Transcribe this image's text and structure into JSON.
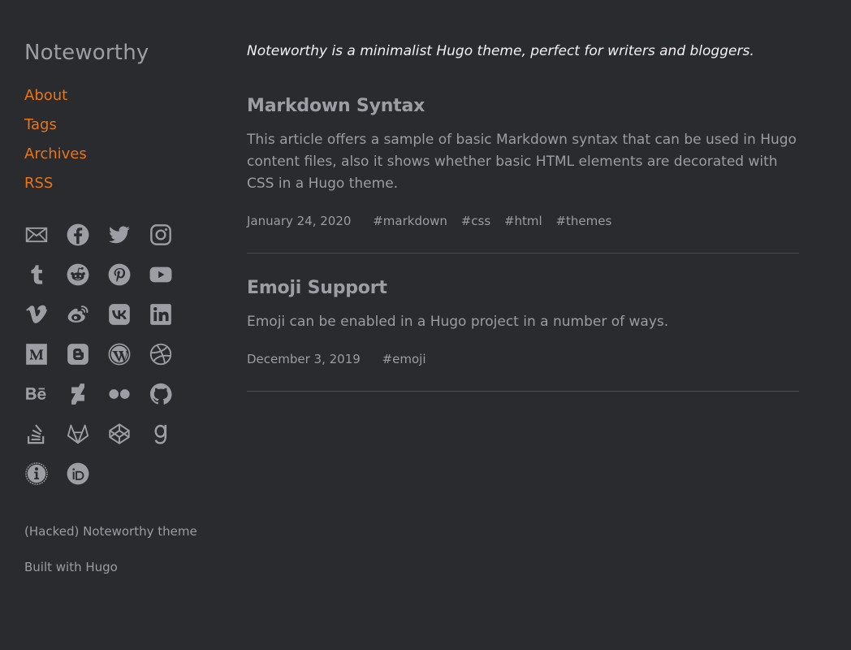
{
  "sidebar": {
    "title": "Noteworthy",
    "nav": [
      "About",
      "Tags",
      "Archives",
      "RSS"
    ],
    "social_icons": [
      "mail-icon",
      "facebook-icon",
      "twitter-icon",
      "instagram-icon",
      "tumblr-icon",
      "reddit-icon",
      "pinterest-icon",
      "youtube-icon",
      "vimeo-icon",
      "weibo-icon",
      "vk-icon",
      "linkedin-icon",
      "medium-icon",
      "blogger-icon",
      "wordpress-icon",
      "dribbble-icon",
      "behance-icon",
      "deviantart-icon",
      "flickr-icon",
      "github-icon",
      "stackoverflow-icon",
      "gitlab-icon",
      "codepen-icon",
      "goodreads-icon",
      "keybase-icon",
      "orcid-icon"
    ],
    "footer": {
      "theme_credit": "(Hacked) Noteworthy theme",
      "built_with": "Built with Hugo"
    }
  },
  "main": {
    "tagline": "Noteworthy is a minimalist Hugo theme, perfect for writers and bloggers.",
    "posts": [
      {
        "title": "Markdown Syntax",
        "excerpt": "This article offers a sample of basic Markdown syntax that can be used in Hugo content files, also it shows whether basic HTML elements are decorated with CSS in a Hugo theme.",
        "date": "January 24, 2020",
        "tags": [
          "#markdown",
          "#css",
          "#html",
          "#themes"
        ]
      },
      {
        "title": "Emoji Support",
        "excerpt": "Emoji can be enabled in a Hugo project in a number of ways.",
        "date": "December 3, 2019",
        "tags": [
          "#emoji"
        ]
      }
    ]
  },
  "colors": {
    "background": "#2a2b2f",
    "accent": "#e8751a",
    "text": "#9c9ca3",
    "tagline": "#f2f2f4",
    "divider": "#4a4b50"
  }
}
